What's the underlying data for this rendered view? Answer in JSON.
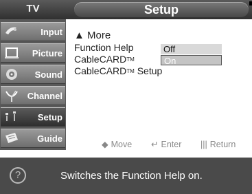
{
  "header": {
    "section_label": "TV",
    "menu_title": "Setup"
  },
  "sidebar": {
    "items": [
      {
        "label": "Input",
        "icon": "input-icon"
      },
      {
        "label": "Picture",
        "icon": "picture-icon"
      },
      {
        "label": "Sound",
        "icon": "sound-icon"
      },
      {
        "label": "Channel",
        "icon": "channel-icon"
      },
      {
        "label": "Setup",
        "icon": "setup-icon",
        "active": true
      },
      {
        "label": "Guide",
        "icon": "guide-icon"
      }
    ]
  },
  "menu": {
    "more_label": "▲ More",
    "function_help_label": "Function Help",
    "cablecard_label": "CableCARD",
    "cablecard_tm": "TM",
    "cablecard_setup_label": "CableCARD",
    "cablecard_setup_tm": "TM",
    "cablecard_setup_suffix": " Setup",
    "options": [
      "Off",
      "On"
    ],
    "selected_option": "On"
  },
  "hints": {
    "move_icon": "◆",
    "move_label": "Move",
    "enter_icon": "↵",
    "enter_label": "Enter",
    "return_icon": "|||",
    "return_label": "Return"
  },
  "footer": {
    "help_icon": "?",
    "description": "Switches the Function Help on."
  },
  "colors": {
    "header_dark": "#303030",
    "sidebar_bg": "#595959",
    "footer_bg": "#4a4a4a",
    "selected_option_bg": "#c4c4c4"
  }
}
